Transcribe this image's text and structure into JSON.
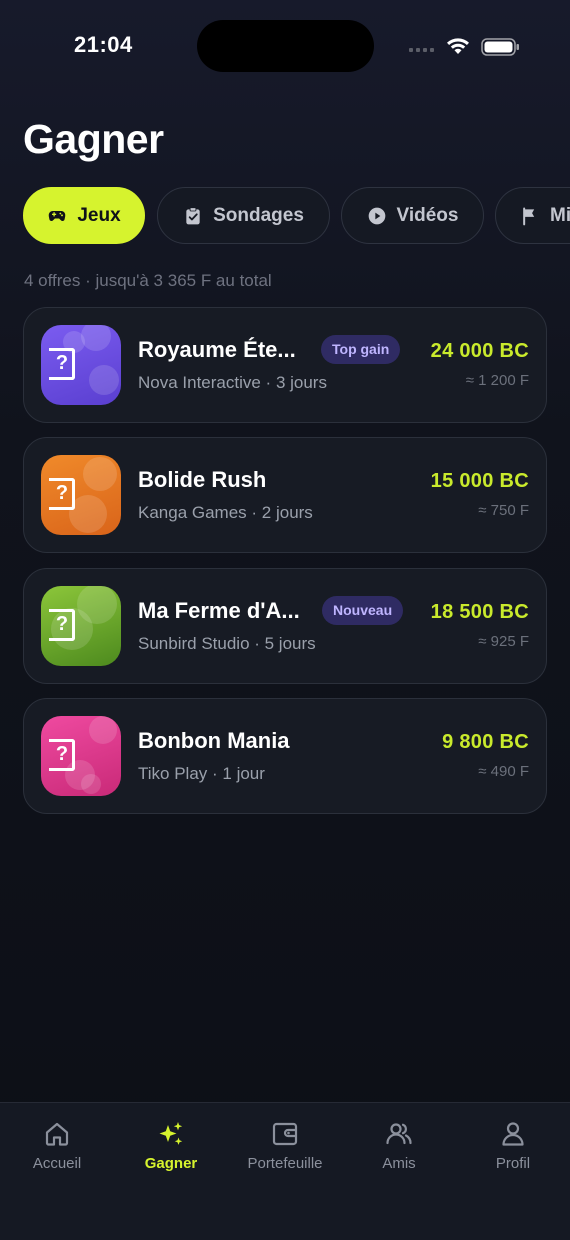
{
  "status": {
    "time": "21:04"
  },
  "header": {
    "title": "Gagner"
  },
  "tabs": [
    {
      "label": "Jeux",
      "icon": "gamepad-icon",
      "active": true
    },
    {
      "label": "Sondages",
      "icon": "clipboard-check-icon",
      "active": false
    },
    {
      "label": "Vidéos",
      "icon": "play-circle-icon",
      "active": false
    },
    {
      "label": "Mi",
      "icon": "flag-icon",
      "active": false
    }
  ],
  "summary": "4 offres · jusqu'à 3 365 F au total",
  "offers": [
    {
      "name": "Royaume Éte...",
      "meta": "Nova Interactive · 3 jours",
      "badge": "Top gain",
      "reward": "24 000 BC",
      "equivalent": "≈ 1 200 F",
      "icon_color_top": "#7b5cf0",
      "icon_color_bottom": "#5a3fd0"
    },
    {
      "name": "Bolide Rush",
      "meta": "Kanga Games · 2 jours",
      "badge": "",
      "reward": "15 000 BC",
      "equivalent": "≈ 750 F",
      "icon_color_top": "#f08a2a",
      "icon_color_bottom": "#d9641a"
    },
    {
      "name": "Ma Ferme d'A...",
      "meta": "Sunbird Studio · 5 jours",
      "badge": "Nouveau",
      "reward": "18 500 BC",
      "equivalent": "≈ 925 F",
      "icon_color_top": "#8cc63a",
      "icon_color_bottom": "#4d8a1e"
    },
    {
      "name": "Bonbon Mania",
      "meta": "Tiko Play · 1 jour",
      "badge": "",
      "reward": "9 800 BC",
      "equivalent": "≈ 490 F",
      "icon_color_top": "#ef4aa0",
      "icon_color_bottom": "#c92a78"
    }
  ],
  "nav": [
    {
      "label": "Accueil",
      "icon": "home-icon",
      "active": false
    },
    {
      "label": "Gagner",
      "icon": "sparkles-icon",
      "active": true
    },
    {
      "label": "Portefeuille",
      "icon": "wallet-icon",
      "active": false
    },
    {
      "label": "Amis",
      "icon": "users-icon",
      "active": false
    },
    {
      "label": "Profil",
      "icon": "user-icon",
      "active": false
    }
  ],
  "colors": {
    "accent": "#d6f32e",
    "reward": "#c9ea2c",
    "badge_bg": "#2f2b63",
    "badge_text": "#bfb5ff"
  }
}
